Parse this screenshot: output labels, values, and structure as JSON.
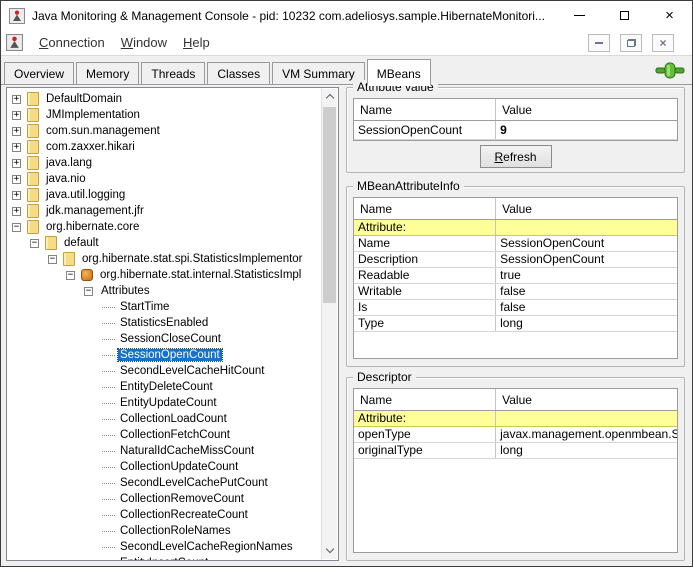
{
  "window": {
    "title": "Java Monitoring & Management Console - pid: 10232 com.adeliosys.sample.HibernateMonitori..."
  },
  "icons": {
    "app": "jconsole-icon",
    "titlebar": [
      "minimize-icon",
      "maximize-icon",
      "close-icon"
    ],
    "frame": [
      "frame-minimize-icon",
      "frame-restore-icon",
      "frame-close-icon"
    ],
    "connection_status": "connected-green-plug-icon",
    "scrollbar": [
      "chevron-up-icon",
      "chevron-down-icon"
    ]
  },
  "menu": {
    "items": [
      {
        "label": "Connection"
      },
      {
        "label": "Window"
      },
      {
        "label": "Help"
      }
    ]
  },
  "tabs": [
    {
      "label": "Overview",
      "selected": false
    },
    {
      "label": "Memory",
      "selected": false
    },
    {
      "label": "Threads",
      "selected": false
    },
    {
      "label": "Classes",
      "selected": false
    },
    {
      "label": "VM Summary",
      "selected": false
    },
    {
      "label": "MBeans",
      "selected": true
    }
  ],
  "tree": {
    "items": [
      {
        "label": "DefaultDomain",
        "level": 0,
        "expand": "plus",
        "icon": "folder"
      },
      {
        "label": "JMImplementation",
        "level": 0,
        "expand": "plus",
        "icon": "folder"
      },
      {
        "label": "com.sun.management",
        "level": 0,
        "expand": "plus",
        "icon": "folder"
      },
      {
        "label": "com.zaxxer.hikari",
        "level": 0,
        "expand": "plus",
        "icon": "folder"
      },
      {
        "label": "java.lang",
        "level": 0,
        "expand": "plus",
        "icon": "folder"
      },
      {
        "label": "java.nio",
        "level": 0,
        "expand": "plus",
        "icon": "folder"
      },
      {
        "label": "java.util.logging",
        "level": 0,
        "expand": "plus",
        "icon": "folder"
      },
      {
        "label": "jdk.management.jfr",
        "level": 0,
        "expand": "plus",
        "icon": "folder"
      },
      {
        "label": "org.hibernate.core",
        "level": 0,
        "expand": "minus",
        "icon": "folder"
      },
      {
        "label": "default",
        "level": 1,
        "expand": "minus",
        "icon": "folder"
      },
      {
        "label": "org.hibernate.stat.spi.StatisticsImplementor",
        "level": 2,
        "expand": "minus",
        "icon": "folder"
      },
      {
        "label": "org.hibernate.stat.internal.StatisticsImpl",
        "level": 3,
        "expand": "minus",
        "icon": "mbean"
      },
      {
        "label": "Attributes",
        "level": 4,
        "expand": "minus",
        "icon": "none"
      },
      {
        "label": "StartTime",
        "level": 5,
        "expand": "none",
        "icon": "none"
      },
      {
        "label": "StatisticsEnabled",
        "level": 5,
        "expand": "none",
        "icon": "none"
      },
      {
        "label": "SessionCloseCount",
        "level": 5,
        "expand": "none",
        "icon": "none"
      },
      {
        "label": "SessionOpenCount",
        "level": 5,
        "expand": "none",
        "icon": "none",
        "selected": true
      },
      {
        "label": "SecondLevelCacheHitCount",
        "level": 5,
        "expand": "none",
        "icon": "none"
      },
      {
        "label": "EntityDeleteCount",
        "level": 5,
        "expand": "none",
        "icon": "none"
      },
      {
        "label": "EntityUpdateCount",
        "level": 5,
        "expand": "none",
        "icon": "none"
      },
      {
        "label": "CollectionLoadCount",
        "level": 5,
        "expand": "none",
        "icon": "none"
      },
      {
        "label": "CollectionFetchCount",
        "level": 5,
        "expand": "none",
        "icon": "none"
      },
      {
        "label": "NaturalIdCacheMissCount",
        "level": 5,
        "expand": "none",
        "icon": "none"
      },
      {
        "label": "CollectionUpdateCount",
        "level": 5,
        "expand": "none",
        "icon": "none"
      },
      {
        "label": "SecondLevelCachePutCount",
        "level": 5,
        "expand": "none",
        "icon": "none"
      },
      {
        "label": "CollectionRemoveCount",
        "level": 5,
        "expand": "none",
        "icon": "none"
      },
      {
        "label": "CollectionRecreateCount",
        "level": 5,
        "expand": "none",
        "icon": "none"
      },
      {
        "label": "CollectionRoleNames",
        "level": 5,
        "expand": "none",
        "icon": "none"
      },
      {
        "label": "SecondLevelCacheRegionNames",
        "level": 5,
        "expand": "none",
        "icon": "none"
      },
      {
        "label": "EntityInsertCount",
        "level": 5,
        "expand": "none",
        "icon": "none"
      }
    ]
  },
  "panels": {
    "attribute_value": {
      "title": "Attribute value",
      "columns": [
        "Name",
        "Value"
      ],
      "rows": [
        {
          "name": "SessionOpenCount",
          "value": "9",
          "bold": true
        }
      ],
      "refresh_label": "Refresh"
    },
    "mbean_attribute_info": {
      "title": "MBeanAttributeInfo",
      "columns": [
        "Name",
        "Value"
      ],
      "rows": [
        {
          "name": "Attribute:",
          "value": "",
          "highlight": true
        },
        {
          "name": "Name",
          "value": "SessionOpenCount"
        },
        {
          "name": "Description",
          "value": "SessionOpenCount"
        },
        {
          "name": "Readable",
          "value": "true"
        },
        {
          "name": "Writable",
          "value": "false"
        },
        {
          "name": "Is",
          "value": "false"
        },
        {
          "name": "Type",
          "value": "long"
        }
      ]
    },
    "descriptor": {
      "title": "Descriptor",
      "columns": [
        "Name",
        "Value"
      ],
      "rows": [
        {
          "name": "Attribute:",
          "value": "",
          "highlight": true
        },
        {
          "name": "openType",
          "value": "javax.management.openmbean.Sim..."
        },
        {
          "name": "originalType",
          "value": "long"
        }
      ]
    }
  },
  "colors": {
    "selection_bg": "#1372ce",
    "highlight_row_bg": "#ffff99",
    "folder_icon": "#f6dd84",
    "mbean_icon": "#d97c1e",
    "connected_green": "#63bf3a",
    "window_bg": "#f0f0f0"
  }
}
